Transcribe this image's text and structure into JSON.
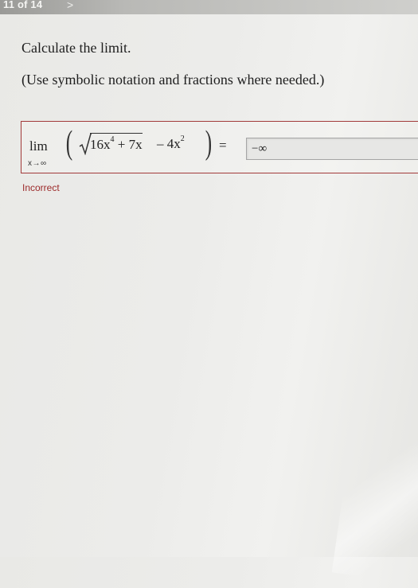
{
  "header": {
    "page_counter": "11 of 14",
    "next_arrow": ">"
  },
  "question": {
    "instruction": "Calculate the limit.",
    "hint": "(Use symbolic notation and fractions where needed.)"
  },
  "expression": {
    "lim_label": "lim",
    "lim_subscript": "x→∞",
    "radicand_base": "16x",
    "radicand_exponent": "4",
    "radicand_tail": " + 7x",
    "minus_term_base": " – 4x",
    "minus_term_exponent": "2",
    "equals": "="
  },
  "answer": {
    "value": "−∞"
  },
  "feedback": {
    "status": "Incorrect",
    "status_color": "#9c2a2a"
  }
}
